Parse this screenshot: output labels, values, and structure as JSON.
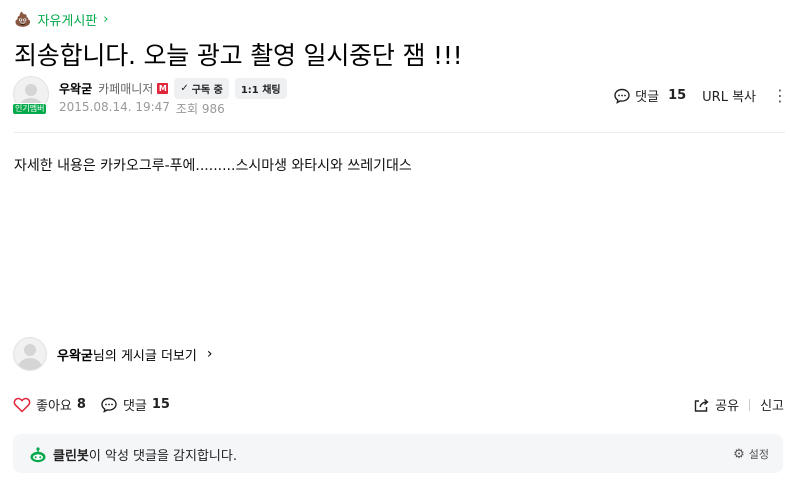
{
  "breadcrumb": {
    "icon": "poop-icon",
    "board": "자유게시판"
  },
  "post": {
    "title": "죄송합니다. 오늘 광고 촬영 일시중단 잼 !!!",
    "body": "자세한 내용은 카카오그루-푸에.........스시마생 와타시와 쓰레기대스"
  },
  "author": {
    "nickname": "우왁굳",
    "role": "카페매니저",
    "manager_badge": "M",
    "level_badge": "인기멤버",
    "subscribe_label": "구독 중",
    "chat_label": "1:1 채팅",
    "date": "2015.08.14. 19:47",
    "views_label": "조회 986"
  },
  "top_actions": {
    "comment_label": "댓글",
    "comment_count": "15",
    "url_copy": "URL 복사"
  },
  "author_more": {
    "nickname": "우왁굳",
    "suffix": "님의 게시글 더보기"
  },
  "bottom_actions": {
    "like_label": "좋아요",
    "like_count": "8",
    "comment_label": "댓글",
    "comment_count": "15",
    "share_label": "공유",
    "report_label": "신고"
  },
  "cleanbot": {
    "name": "클린봇",
    "message": "이 악성 댓글을 감지합니다.",
    "settings_label": "설정"
  },
  "colors": {
    "accent": "#03a94b",
    "manager": "#e0263a",
    "like": "#e0263a"
  }
}
